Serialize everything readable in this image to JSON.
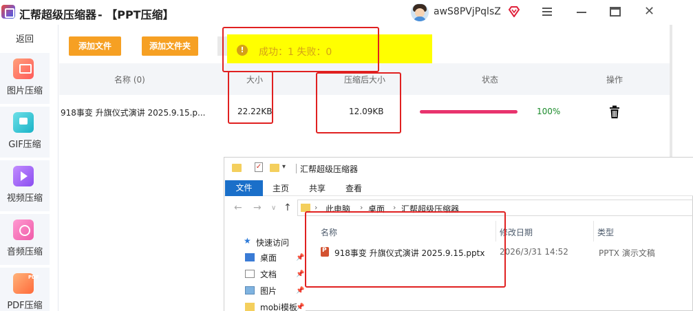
{
  "titlebar": {
    "app_title": "汇帮超级压缩器",
    "page_title": "-  【PPT压缩】",
    "username": "awS8PVjPqlsZ"
  },
  "sidebar": {
    "back_label": "返回",
    "items": [
      {
        "label": "图片压缩",
        "icon": "image-icon"
      },
      {
        "label": "GIF压缩",
        "icon": "gif-icon"
      },
      {
        "label": "视频压缩",
        "icon": "video-icon"
      },
      {
        "label": "音频压缩",
        "icon": "audio-icon"
      },
      {
        "label": "PDF压缩",
        "icon": "pdf-icon",
        "tag": "PDF"
      }
    ]
  },
  "toolbar": {
    "add_file_label": "添加文件",
    "add_folder_label": "添加文件夹"
  },
  "toast": {
    "message": "成功：1    失败：0"
  },
  "table": {
    "headers": {
      "name": "名称 (0)",
      "size": "大小",
      "compressed_size": "压缩后大小",
      "status": "状态",
      "actions": "操作"
    },
    "rows": [
      {
        "name": "918事变 升旗仪式演讲 2025.9.15.p...",
        "size": "22.22KB",
        "compressed_size": "12.09KB",
        "progress": 1.0,
        "progress_text": "100%"
      }
    ]
  },
  "explorer": {
    "title": "汇帮超级压缩器",
    "ribbon_tabs": [
      "文件",
      "主页",
      "共享",
      "查看"
    ],
    "breadcrumb": [
      "此电脑",
      "桌面",
      "汇帮超级压缩器"
    ],
    "nav_items": [
      {
        "label": "快速访问"
      },
      {
        "label": "桌面"
      },
      {
        "label": "文档"
      },
      {
        "label": "图片"
      },
      {
        "label": "mobi模板"
      }
    ],
    "columns": {
      "name": "名称",
      "modified": "修改日期",
      "type": "类型"
    },
    "files": [
      {
        "name": "918事变 升旗仪式演讲 2025.9.15.pptx",
        "modified": "2026/3/31 14:52",
        "type": "PPTX 演示文稿"
      }
    ]
  },
  "colors": {
    "accent_orange": "#f6a023",
    "toast_yellow": "#ffff00",
    "progress_pink": "#e8336d",
    "success_green": "#1a8a2a",
    "highlight_red": "#e02020",
    "explorer_blue": "#1a6fc9"
  }
}
